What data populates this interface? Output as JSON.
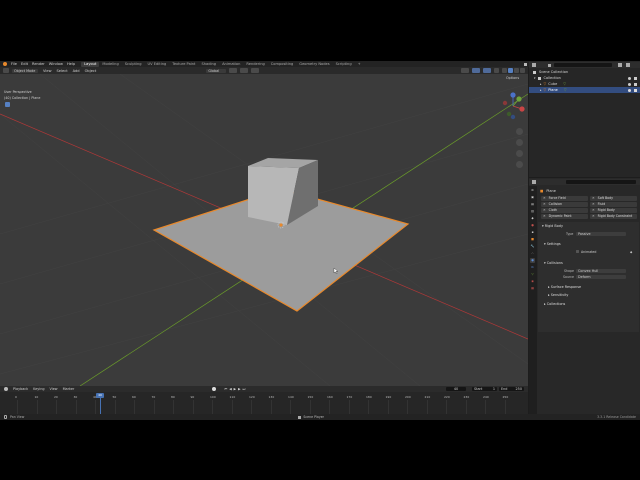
{
  "topbar": {
    "menus": [
      "File",
      "Edit",
      "Render",
      "Window",
      "Help"
    ],
    "workspaces": [
      "Layout",
      "Modeling",
      "Sculpting",
      "UV Editing",
      "Texture Paint",
      "Shading",
      "Animation",
      "Rendering",
      "Compositing",
      "Geometry Nodes",
      "Scripting"
    ],
    "active_workspace": "Layout",
    "add_tab": "+",
    "scene": "Scene",
    "view_layer": "ViewLayer"
  },
  "viewport": {
    "mode": "Object Mode",
    "menus": [
      "View",
      "Select",
      "Add",
      "Object"
    ],
    "orientation": "Global",
    "view_name": "User Perspective",
    "collection_path": "(40) Collection | Plane",
    "options": "Options"
  },
  "outliner": {
    "search_placeholder": "",
    "root": "Scene Collection",
    "items": [
      {
        "label": "Collection",
        "icon": "collection-icon"
      },
      {
        "label": "Cube",
        "icon": "mesh-icon"
      },
      {
        "label": "Plane",
        "icon": "mesh-icon",
        "selected": true
      }
    ]
  },
  "properties": {
    "object_name": "Plane",
    "physics_buttons": [
      "Force Field",
      "Soft Body",
      "Collision",
      "Fluid",
      "Cloth",
      "Rigid Body",
      "Dynamic Paint",
      "Rigid Body Constraint"
    ],
    "rigid_body": {
      "header": "Rigid Body",
      "type_label": "Type",
      "type_value": "Passive",
      "settings": "Settings",
      "animated": "Animated",
      "collisions": "Collisions",
      "shape_label": "Shape",
      "shape_value": "Convex Hull",
      "source_label": "Source",
      "source_value": "Deform",
      "surface_response": "Surface Response",
      "sensitivity": "Sensitivity",
      "collections": "Collections"
    }
  },
  "timeline": {
    "menus": [
      "Playback",
      "Keying",
      "View",
      "Marker"
    ],
    "current_frame": "40",
    "start_label": "Start",
    "start": "1",
    "end_label": "End",
    "end": "250",
    "ticks": [
      "0",
      "10",
      "20",
      "30",
      "40",
      "50",
      "60",
      "70",
      "80",
      "90",
      "100",
      "110",
      "120",
      "130",
      "140",
      "150",
      "160",
      "170",
      "180",
      "190",
      "200",
      "210",
      "220",
      "230",
      "240",
      "250"
    ]
  },
  "statusbar": {
    "left": "Pan View",
    "middle": "Scene Player",
    "right": "3.3.1 Release Candidate"
  },
  "colors": {
    "accent_orange": "#e8892c",
    "selection_blue": "#334d80",
    "x_axis": "#b03838",
    "y_axis": "#6a9c2a"
  }
}
